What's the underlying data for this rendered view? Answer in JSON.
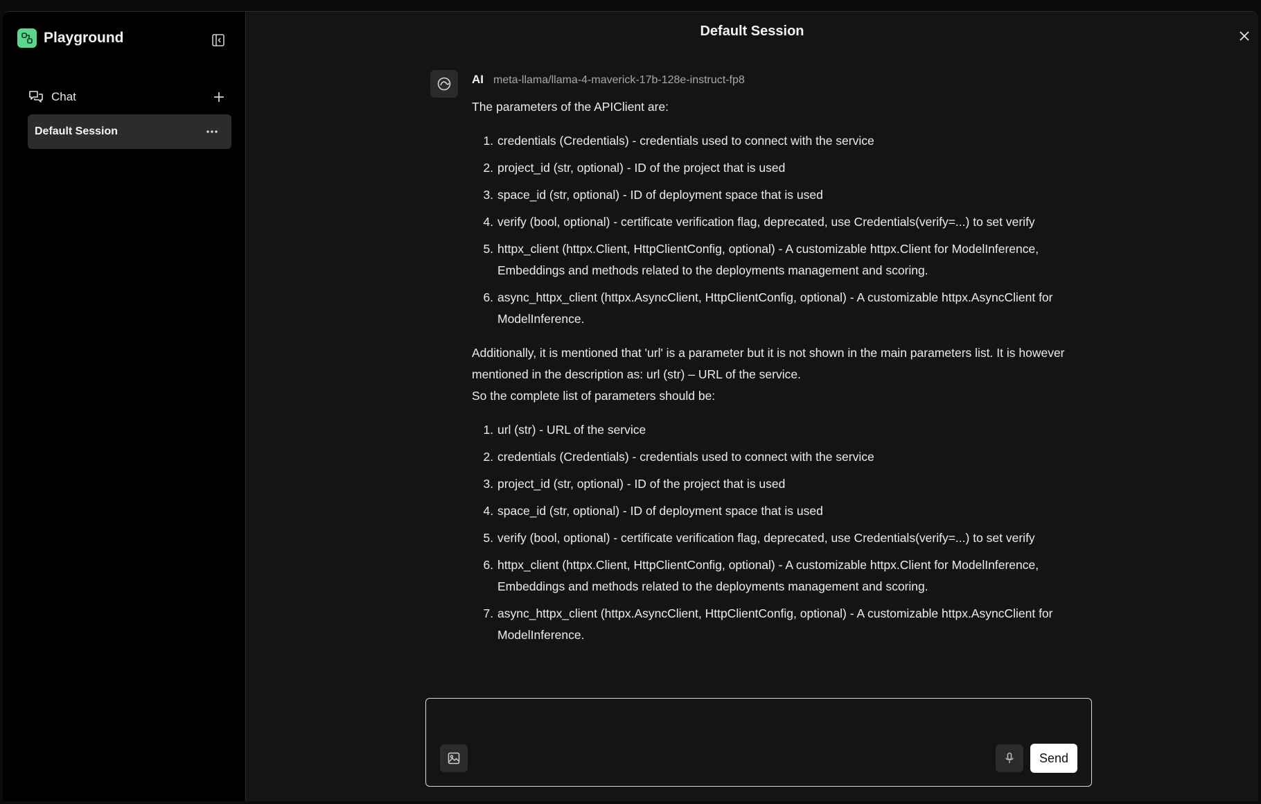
{
  "sidebar": {
    "brand_title": "Playground",
    "section_label": "Chat",
    "sessions": [
      {
        "label": "Default Session"
      }
    ]
  },
  "main": {
    "session_title": "Default Session",
    "message": {
      "sender": "AI",
      "model": "meta-llama/llama-4-maverick-17b-128e-instruct-fp8",
      "intro": "The parameters of the APIClient are:",
      "list1": [
        "credentials (Credentials) - credentials used to connect with the service",
        "project_id (str, optional) - ID of the project that is used",
        "space_id (str, optional) - ID of deployment space that is used",
        "verify (bool, optional) - certificate verification flag, deprecated, use Credentials(verify=...) to set verify",
        "httpx_client (httpx.Client, HttpClientConfig, optional) - A customizable httpx.Client for ModelInference, Embeddings and methods related to the deployments management and scoring.",
        "async_httpx_client (httpx.AsyncClient, HttpClientConfig, optional) - A customizable httpx.AsyncClient for ModelInference."
      ],
      "para2": "Additionally, it is mentioned that 'url' is a parameter but it is not shown in the main parameters list. It is however mentioned in the description as: url (str) – URL of the service.",
      "para3": "So the complete list of parameters should be:",
      "list2": [
        "url (str) - URL of the service",
        "credentials (Credentials) - credentials used to connect with the service",
        "project_id (str, optional) - ID of the project that is used",
        "space_id (str, optional) - ID of deployment space that is used",
        "verify (bool, optional) - certificate verification flag, deprecated, use Credentials(verify=...) to set verify",
        "httpx_client (httpx.Client, HttpClientConfig, optional) - A customizable httpx.Client for ModelInference, Embeddings and methods related to the deployments management and scoring.",
        "async_httpx_client (httpx.AsyncClient, HttpClientConfig, optional) - A customizable httpx.AsyncClient for ModelInference."
      ]
    }
  },
  "composer": {
    "value": "",
    "placeholder": "",
    "send_label": "Send"
  },
  "icons": {
    "brand": "playground-logo-icon",
    "collapse": "sidebar-collapse-icon",
    "chat": "chat-bubbles-icon",
    "add": "plus-icon",
    "more": "more-horizontal-icon",
    "close": "close-icon",
    "avatar": "ai-avatar-icon",
    "image": "image-upload-icon",
    "mic": "microphone-icon"
  },
  "colors": {
    "accent": "#5bd68a",
    "sidebar_bg": "#000000",
    "main_bg": "#141414",
    "selected_session_bg": "#2c2c2c",
    "send_button_bg": "#ffffff"
  }
}
